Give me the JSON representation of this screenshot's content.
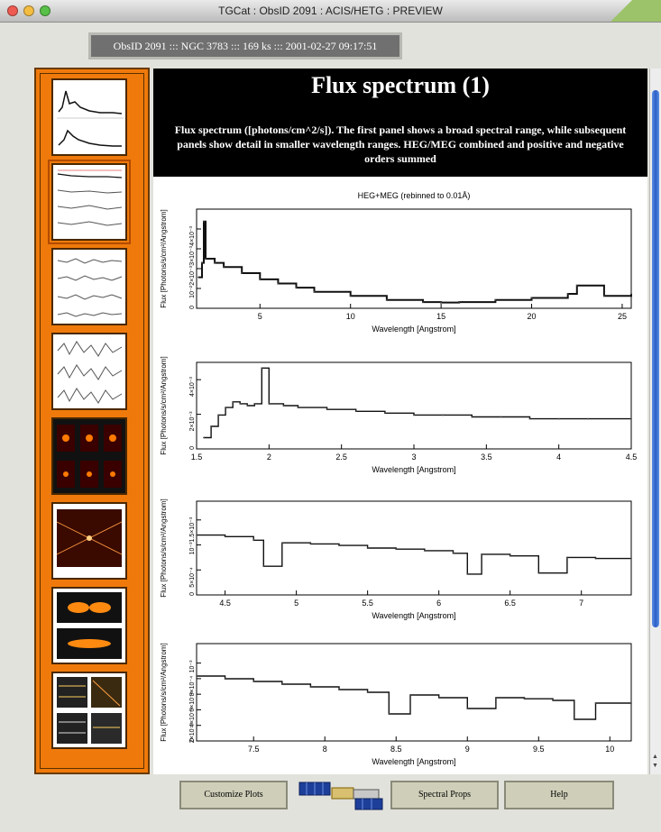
{
  "window": {
    "title": "TGCat : ObsID 2091 : ACIS/HETG : PREVIEW"
  },
  "obs_info": "ObsID 2091 ::: NGC 3783 ::: 169 ks ::: 2001-02-27 09:17:51",
  "panel": {
    "title": "Flux spectrum (1)",
    "description": "Flux spectrum ([photons/cm^2/s]). The first panel shows a broad spectral range, while subsequent panels show detail in smaller wavelength ranges. HEG/MEG combined and positive and negative orders summed"
  },
  "chart_data": [
    {
      "type": "line",
      "title": "HEG+MEG (rebinned to 0.01Å)",
      "xlabel": "Wavelength [Angstrom]",
      "ylabel": "Flux [Photons/s/cm²/Angstrom]",
      "xlim": [
        1.5,
        25.5
      ],
      "ylim": [
        0,
        0.0048
      ],
      "xticks": [
        "5",
        "10",
        "15",
        "20",
        "25"
      ],
      "yticks": [
        "0",
        "10⁻²",
        "2×10⁻³",
        "3×10⁻³",
        "4×10⁻³"
      ],
      "x": [
        1.6,
        1.8,
        1.9,
        2.0,
        2.5,
        3.0,
        4.0,
        5.0,
        6.0,
        7.0,
        8.0,
        10.0,
        12.0,
        14.0,
        15.0,
        16.0,
        18.0,
        20.0,
        22.0,
        22.5,
        24.0,
        25.5
      ],
      "y": [
        0.0015,
        0.0022,
        0.0042,
        0.0024,
        0.0022,
        0.002,
        0.0017,
        0.0014,
        0.0012,
        0.001,
        0.0008,
        0.0006,
        0.0004,
        0.0003,
        0.00028,
        0.0003,
        0.0004,
        0.0005,
        0.0007,
        0.0011,
        0.0006,
        0.0007
      ]
    },
    {
      "type": "line",
      "xlabel": "Wavelength [Angstrom]",
      "ylabel": "Flux [Photons/s/cm²/Angstrom]",
      "xlim": [
        1.5,
        4.5
      ],
      "ylim": [
        0,
        0.0046
      ],
      "xticks": [
        "1.5",
        "2",
        "2.5",
        "3",
        "3.5",
        "4",
        "4.5"
      ],
      "yticks": [
        "0",
        "2×10⁻³",
        "4×10⁻³"
      ],
      "x": [
        1.55,
        1.6,
        1.65,
        1.7,
        1.75,
        1.8,
        1.85,
        1.9,
        1.95,
        2.0,
        2.1,
        2.2,
        2.4,
        2.6,
        2.8,
        3.0,
        3.2,
        3.4,
        3.6,
        3.8,
        4.0,
        4.2,
        4.5
      ],
      "y": [
        0.0006,
        0.0012,
        0.0018,
        0.0022,
        0.0025,
        0.0024,
        0.0023,
        0.0024,
        0.0043,
        0.0024,
        0.0023,
        0.0022,
        0.0021,
        0.002,
        0.0019,
        0.0018,
        0.0018,
        0.0017,
        0.0017,
        0.0016,
        0.0016,
        0.0016,
        0.0016
      ]
    },
    {
      "type": "line",
      "xlabel": "Wavelength [Angstrom]",
      "ylabel": "Flux [Photons/s/cm²/Angstrom]",
      "xlim": [
        4.3,
        7.35
      ],
      "ylim": [
        0,
        0.0018
      ],
      "xticks": [
        "4.5",
        "5",
        "5.5",
        "6",
        "6.5",
        "7"
      ],
      "yticks": [
        "0",
        "5×10⁻⁴",
        "10⁻³",
        "1.5×10⁻³"
      ],
      "x": [
        4.3,
        4.5,
        4.7,
        4.77,
        4.9,
        5.1,
        5.3,
        5.5,
        5.7,
        5.9,
        6.1,
        6.2,
        6.3,
        6.5,
        6.7,
        6.9,
        7.1,
        7.35
      ],
      "y": [
        0.00115,
        0.00112,
        0.00105,
        0.00055,
        0.001,
        0.00098,
        0.00095,
        0.0009,
        0.00088,
        0.00085,
        0.0008,
        0.0004,
        0.00078,
        0.00075,
        0.00042,
        0.00072,
        0.0007,
        0.0007
      ]
    },
    {
      "type": "line",
      "xlabel": "Wavelength [Angstrom]",
      "ylabel": "Flux [Photons/s/cm²/Angstrom]",
      "xlim": [
        7.1,
        10.15
      ],
      "ylim": [
        0,
        0.0018
      ],
      "xticks": [
        "7.5",
        "8",
        "8.5",
        "9",
        "9.5",
        "10"
      ],
      "yticks": [
        "0",
        "2×10⁻⁴",
        "4×10⁻⁴",
        "6×10⁻⁴",
        "8×10⁻⁴",
        "10⁻³"
      ],
      "x": [
        7.1,
        7.3,
        7.5,
        7.7,
        7.9,
        8.1,
        8.3,
        8.45,
        8.6,
        8.8,
        9.0,
        9.2,
        9.4,
        9.6,
        9.75,
        9.9,
        10.15
      ],
      "y": [
        0.0012,
        0.00115,
        0.0011,
        0.00105,
        0.001,
        0.00095,
        0.0009,
        0.0005,
        0.00085,
        0.0008,
        0.0006,
        0.0008,
        0.00078,
        0.00075,
        0.0004,
        0.0007,
        0.0007
      ]
    }
  ],
  "buttons": {
    "customize": "Customize Plots",
    "spectral": "Spectral Props",
    "help": "Help"
  },
  "colors": {
    "sidebar": "#ef7a0b",
    "header_bg": "#000000",
    "button": "#cfcfb9",
    "scroll": "#2c5fc7"
  },
  "icons": {
    "satellite": "chandra-satellite-icon"
  }
}
